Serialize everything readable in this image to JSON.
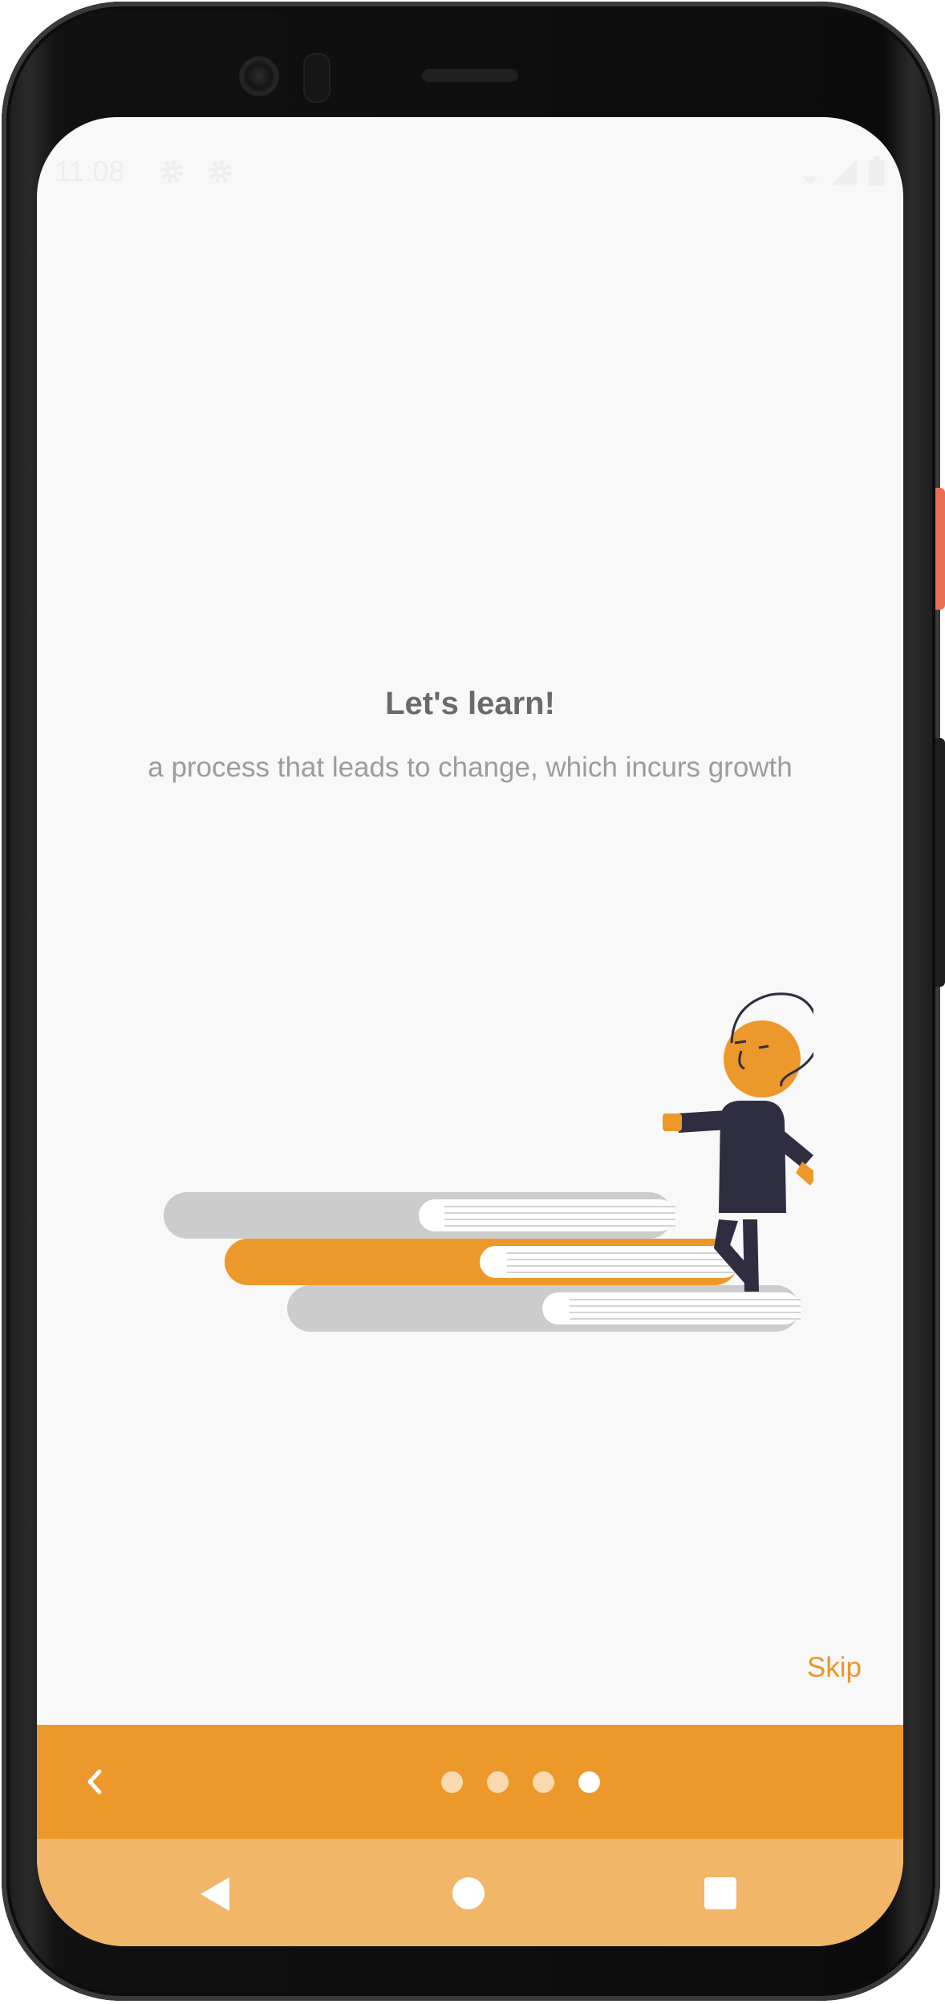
{
  "status_bar": {
    "time": "11:08",
    "icons": [
      "gear-icon",
      "gear-icon",
      "wifi-icon",
      "signal-icon",
      "battery-icon"
    ]
  },
  "onboarding": {
    "title": "Let's learn!",
    "subtitle": "a process that leads to change, which incurs growth",
    "illustration": "person-walking-on-books",
    "skip_label": "Skip"
  },
  "pager": {
    "back_icon": "chevron-left-icon",
    "page_count": 4,
    "current_page": 4
  },
  "system_nav": {
    "buttons": [
      "back",
      "home",
      "recents"
    ]
  },
  "colors": {
    "accent": "#ec982b",
    "nav_bar": "#f1b667",
    "title": "#6a6a6a",
    "subtitle": "#9c9c9c",
    "book_gray": "#cccccc",
    "figure_dark": "#2f2e41"
  }
}
